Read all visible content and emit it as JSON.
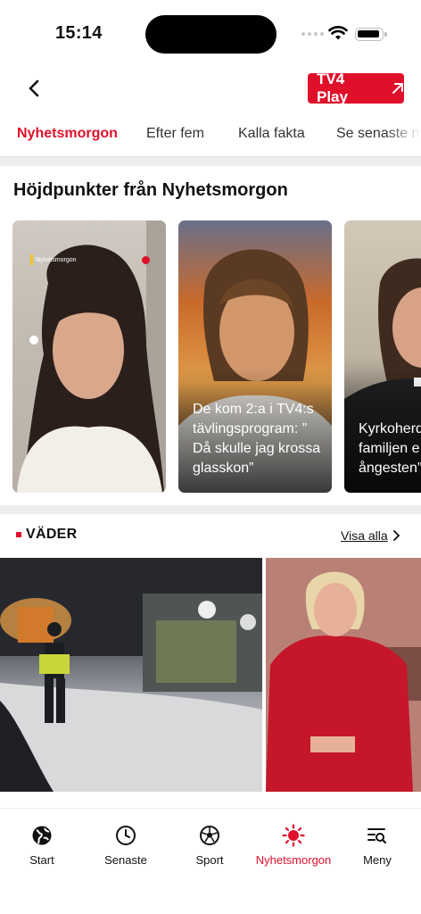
{
  "status_bar": {
    "time": "15:14"
  },
  "header": {
    "back_icon": "chevron-left-icon",
    "tv4_play_label": "TV4 Play",
    "tv4_play_icon": "arrow-up-right-icon",
    "accent_color": "#e0102b"
  },
  "tabs": [
    {
      "label": "Nyhetsmorgon",
      "active": true
    },
    {
      "label": "Efter fem",
      "active": false
    },
    {
      "label": "Kalla fakta",
      "active": false
    },
    {
      "label": "Se senaste ny",
      "active": false
    }
  ],
  "highlights": {
    "title": "Höjdpunkter från Nyhetsmorgon",
    "cards": [
      {
        "brand": "Nyhetsmorgon",
        "caption": ""
      },
      {
        "caption": "De kom 2:a i TV4:s tävlingsprogram: ” Då skulle jag krossa glasskon”"
      },
      {
        "caption": "Kyrkoherd Hedrar va familjen e att fastna ångesten”"
      }
    ]
  },
  "weather": {
    "title": "VÄDER",
    "see_all": "Visa alla"
  },
  "bottom_nav": [
    {
      "label": "Start",
      "icon": "globe-icon",
      "active": false
    },
    {
      "label": "Senaste",
      "icon": "clock-icon",
      "active": false
    },
    {
      "label": "Sport",
      "icon": "football-icon",
      "active": false
    },
    {
      "label": "Nyhetsmorgon",
      "icon": "sun-icon",
      "active": true
    },
    {
      "label": "Meny",
      "icon": "menu-search-icon",
      "active": false
    }
  ]
}
